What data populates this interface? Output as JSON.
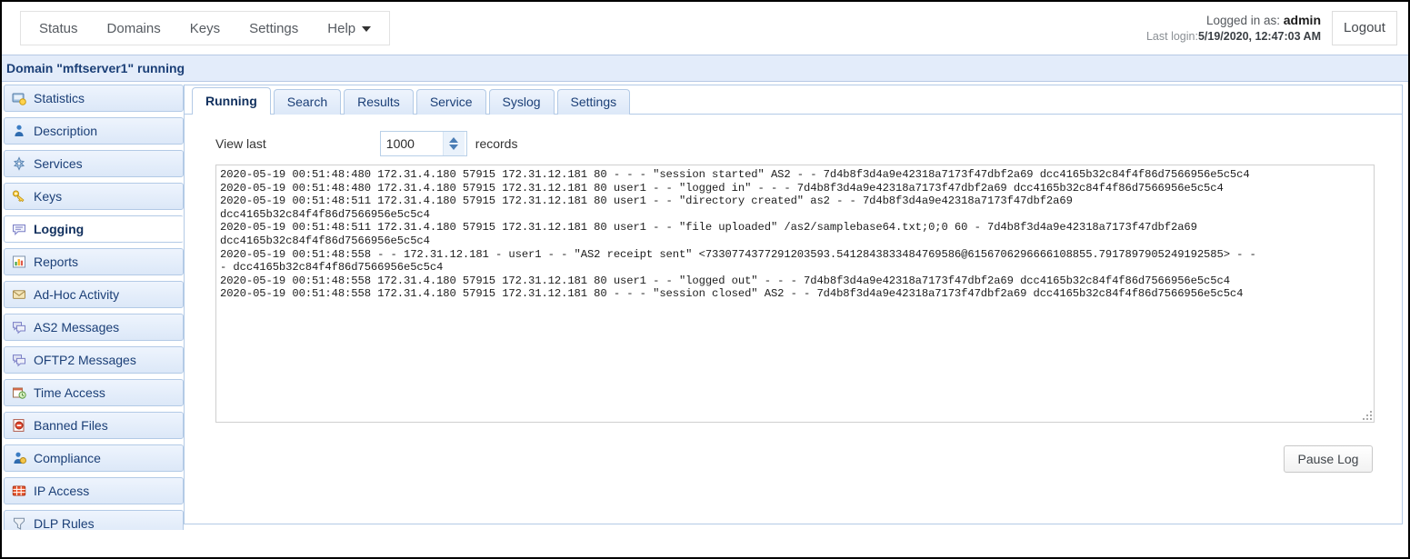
{
  "topbar": {
    "menu": [
      {
        "label": "Status",
        "icon": "none"
      },
      {
        "label": "Domains",
        "icon": "none"
      },
      {
        "label": "Keys",
        "icon": "none"
      },
      {
        "label": "Settings",
        "icon": "none"
      },
      {
        "label": "Help",
        "icon": "chevron-down-icon"
      }
    ],
    "logged_in_prefix": "Logged in as: ",
    "logged_in_user": "admin",
    "last_login_prefix": "Last login:",
    "last_login_value": "5/19/2020, 12:47:03 AM",
    "logout_label": "Logout"
  },
  "domain_banner": {
    "text": "Domain \"mftserver1\" running",
    "bg": "#e3ecfa",
    "fg": "#1b3f77"
  },
  "sidebar": {
    "items": [
      {
        "label": "Statistics",
        "icon": "statistics-icon",
        "active": false
      },
      {
        "label": "Description",
        "icon": "description-icon",
        "active": false
      },
      {
        "label": "Services",
        "icon": "services-icon",
        "active": false
      },
      {
        "label": "Keys",
        "icon": "keys-icon",
        "active": false
      },
      {
        "label": "Logging",
        "icon": "logging-icon",
        "active": true
      },
      {
        "label": "Reports",
        "icon": "reports-icon",
        "active": false
      },
      {
        "label": "Ad-Hoc Activity",
        "icon": "adhoc-activity-icon",
        "active": false
      },
      {
        "label": "AS2 Messages",
        "icon": "as2-messages-icon",
        "active": false
      },
      {
        "label": "OFTP2 Messages",
        "icon": "oftp2-messages-icon",
        "active": false
      },
      {
        "label": "Time Access",
        "icon": "time-access-icon",
        "active": false
      },
      {
        "label": "Banned Files",
        "icon": "banned-files-icon",
        "active": false
      },
      {
        "label": "Compliance",
        "icon": "compliance-icon",
        "active": false
      },
      {
        "label": "IP Access",
        "icon": "ip-access-icon",
        "active": false
      },
      {
        "label": "DLP Rules",
        "icon": "dlp-rules-icon",
        "active": false
      }
    ]
  },
  "tabs": [
    {
      "label": "Running",
      "active": true
    },
    {
      "label": "Search",
      "active": false
    },
    {
      "label": "Results",
      "active": false
    },
    {
      "label": "Service",
      "active": false
    },
    {
      "label": "Syslog",
      "active": false
    },
    {
      "label": "Settings",
      "active": false
    }
  ],
  "panel": {
    "view_last_label": "View last",
    "records_count_value": "1000",
    "records_count_placeholder": "1000",
    "records_label": "records",
    "pause_log_label": "Pause Log",
    "log_lines": [
      "2020-05-19 00:51:48:480 172.31.4.180 57915 172.31.12.181 80 - - - \"session started\" AS2 - - 7d4b8f3d4a9e42318a7173f47dbf2a69 dcc4165b32c84f4f86d7566956e5c5c4",
      "2020-05-19 00:51:48:480 172.31.4.180 57915 172.31.12.181 80 user1 - - \"logged in\" - - - 7d4b8f3d4a9e42318a7173f47dbf2a69 dcc4165b32c84f4f86d7566956e5c5c4",
      "2020-05-19 00:51:48:511 172.31.4.180 57915 172.31.12.181 80 user1 - - \"directory created\" as2 - - 7d4b8f3d4a9e42318a7173f47dbf2a69",
      "dcc4165b32c84f4f86d7566956e5c5c4",
      "2020-05-19 00:51:48:511 172.31.4.180 57915 172.31.12.181 80 user1 - - \"file uploaded\" /as2/samplebase64.txt;0;0 60 - 7d4b8f3d4a9e42318a7173f47dbf2a69",
      "dcc4165b32c84f4f86d7566956e5c5c4",
      "2020-05-19 00:51:48:558 - - 172.31.12.181 - user1 - - \"AS2 receipt sent\" <7330774377291203593.5412843833484769586@6156706296666108855.7917897905249192585> - -",
      "- dcc4165b32c84f4f86d7566956e5c5c4",
      "2020-05-19 00:51:48:558 172.31.4.180 57915 172.31.12.181 80 user1 - - \"logged out\" - - - 7d4b8f3d4a9e42318a7173f47dbf2a69 dcc4165b32c84f4f86d7566956e5c5c4",
      "2020-05-19 00:51:48:558 172.31.4.180 57915 172.31.12.181 80 - - - \"session closed\" AS2 - - 7d4b8f3d4a9e42318a7173f47dbf2a69 dcc4165b32c84f4f86d7566956e5c5c4"
    ]
  }
}
